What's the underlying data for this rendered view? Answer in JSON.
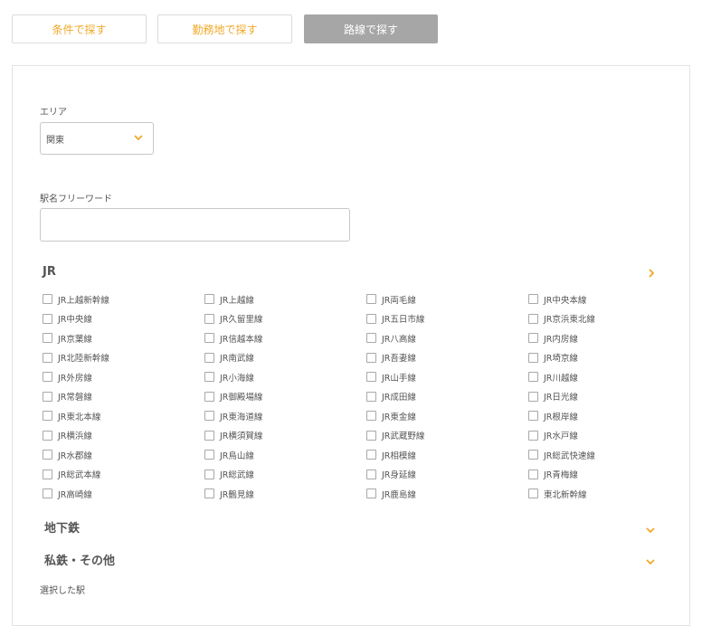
{
  "tabs": [
    {
      "label": "条件で探す"
    },
    {
      "label": "勤務地で探す"
    },
    {
      "label": "路線で探す"
    }
  ],
  "area": {
    "label": "エリア",
    "value": "関東"
  },
  "freeword": {
    "label": "駅名フリーワード",
    "value": ""
  },
  "sections": {
    "jr": "JR",
    "subway": "地下鉄",
    "private": "私鉄・その他"
  },
  "jr_lines": [
    "JR上越新幹線",
    "JR上越線",
    "JR両毛線",
    "JR中央本線",
    "JR中央線",
    "JR久留里線",
    "JR五日市線",
    "JR京浜東北線",
    "JR京葉線",
    "JR信越本線",
    "JR八高線",
    "JR内房線",
    "JR北陸新幹線",
    "JR南武線",
    "JR吾妻線",
    "JR埼京線",
    "JR外房線",
    "JR小海線",
    "JR山手線",
    "JR川越線",
    "JR常磐線",
    "JR御殿場線",
    "JR成田線",
    "JR日光線",
    "JR東北本線",
    "JR東海道線",
    "JR東金線",
    "JR根岸線",
    "JR横浜線",
    "JR横須賀線",
    "JR武蔵野線",
    "JR水戸線",
    "JR水郡線",
    "JR烏山線",
    "JR相模線",
    "JR総武快速線",
    "JR総武本線",
    "JR総武線",
    "JR身延線",
    "JR青梅線",
    "JR高崎線",
    "JR鶴見線",
    "JR鹿島線",
    "東北新幹線"
  ],
  "selected_label": "選択した駅",
  "colors": {
    "accent": "#f0a92a",
    "active_tab": "#a6a6a6"
  }
}
